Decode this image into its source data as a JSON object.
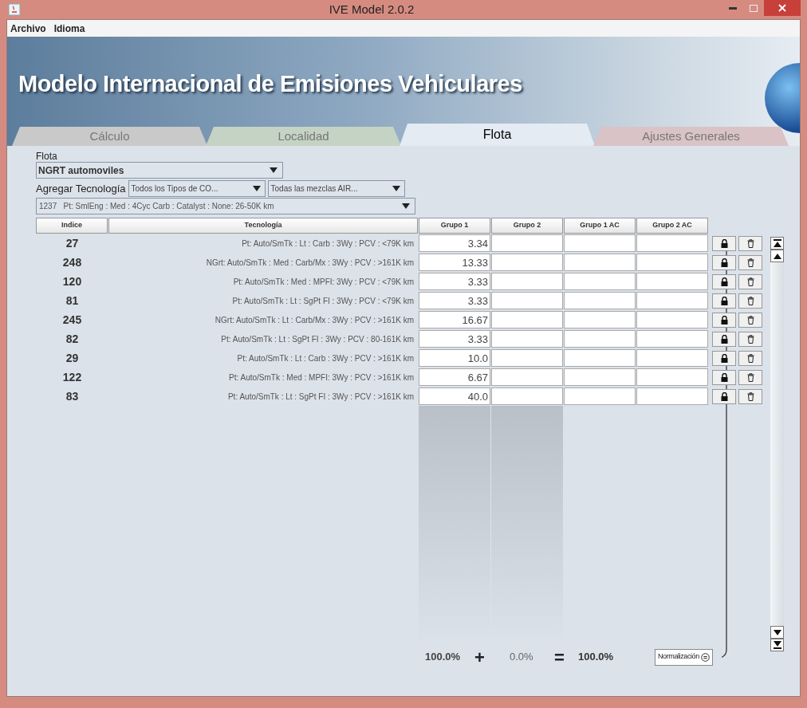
{
  "window": {
    "title": "IVE Model 2.0.2"
  },
  "menu": [
    "Archivo",
    "Idioma"
  ],
  "banner": {
    "title": "Modelo Internacional de Emisiones Vehiculares"
  },
  "tabs": [
    {
      "label": "Cálculo",
      "selected": false,
      "color": "#c9c9c9"
    },
    {
      "label": "Localidad",
      "selected": false,
      "color": "#c5d3c4"
    },
    {
      "label": "Flota",
      "selected": true,
      "color": "#e4ebf3"
    },
    {
      "label": "Ajustes Generales",
      "selected": false,
      "color": "#d9c3c6"
    }
  ],
  "fleet": {
    "label": "Flota",
    "value": "NGRT automoviles"
  },
  "add_technology": {
    "label": "Agregar Tecnología",
    "filters": [
      "Todos los Tipos de CO...",
      "Todas las mezclas AIR..."
    ],
    "selection": "1237   Pt: SmlEng : Med : 4Cyc Carb : Catalyst : None: 26-50K km"
  },
  "table": {
    "columns": [
      "Indice",
      "Tecnología",
      "Grupo 1",
      "Grupo 2",
      "Grupo 1 AC",
      "Grupo 2 AC"
    ],
    "rows": [
      {
        "index": "27",
        "technology": "Pt: Auto/SmTk : Lt : Carb : 3Wy : PCV : <79K km",
        "grupo_1": "3.34"
      },
      {
        "index": "248",
        "technology": "NGrt: Auto/SmTk : Med : Carb/Mx : 3Wy : PCV : >161K km",
        "grupo_1": "13.33"
      },
      {
        "index": "120",
        "technology": "Pt: Auto/SmTk : Med : MPFI: 3Wy : PCV : <79K km",
        "grupo_1": "3.33"
      },
      {
        "index": "81",
        "technology": "Pt: Auto/SmTk : Lt : SgPt FI : 3Wy : PCV : <79K km",
        "grupo_1": "3.33"
      },
      {
        "index": "245",
        "technology": "NGrt: Auto/SmTk : Lt : Carb/Mx : 3Wy : PCV : >161K km",
        "grupo_1": "16.67"
      },
      {
        "index": "82",
        "technology": "Pt: Auto/SmTk : Lt : SgPt FI : 3Wy : PCV : 80-161K km",
        "grupo_1": "3.33"
      },
      {
        "index": "29",
        "technology": "Pt: Auto/SmTk : Lt : Carb : 3Wy : PCV : >161K km",
        "grupo_1": "10.0"
      },
      {
        "index": "122",
        "technology": "Pt: Auto/SmTk : Med : MPFI: 3Wy : PCV : >161K km",
        "grupo_1": "6.67"
      },
      {
        "index": "83",
        "technology": "Pt: Auto/SmTk : Lt : SgPt FI : 3Wy : PCV : >161K km",
        "grupo_1": "40.0"
      }
    ]
  },
  "totals": {
    "grupo_1": "100.0%",
    "plus": "+",
    "grupo_2": "0.0%",
    "equals": "=",
    "total": "100.0%"
  },
  "normalize_button": "Normalización"
}
